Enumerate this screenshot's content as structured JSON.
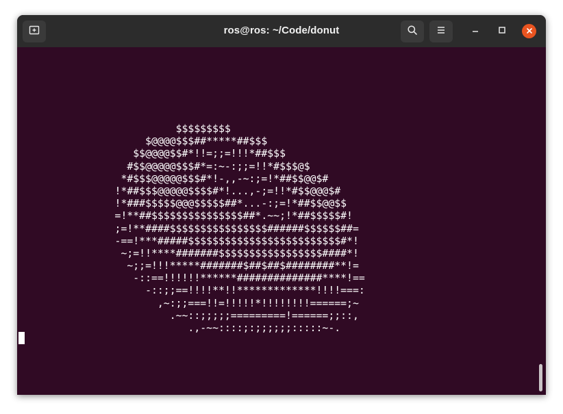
{
  "window": {
    "title": "ros@ros: ~/Code/donut"
  },
  "titlebar": {
    "buttons": [
      {
        "name": "new-tab",
        "icon": "new-tab-icon"
      },
      {
        "name": "search",
        "icon": "search-icon"
      },
      {
        "name": "menu",
        "icon": "hamburger-menu-icon"
      }
    ],
    "window_controls": [
      {
        "name": "minimize",
        "icon": "minimize-icon"
      },
      {
        "name": "maximize",
        "icon": "maximize-icon"
      },
      {
        "name": "close",
        "icon": "close-icon"
      }
    ]
  },
  "terminal": {
    "background": "#300a24",
    "foreground": "#ffffff",
    "output_lines": [
      "                          $$$$$$$$$",
      "                     $@@@@$$$##*****##$$$",
      "                   $$@@@@$$#*!!=;;=!!!*##$$$",
      "                  #$$@@@@@$$$#*=:~-:;;=!!*#$$$@$",
      "                 *#$$$@@@@@$$$#*!-,,-~:;=!*##$$@@$#",
      "                !*##$$$@@@@@$$$$#*!...,-;=!!*#$$@@@$#",
      "                !*###$$$$$@@@$$$$$##*...-:;=!*##$$@@$$",
      "                =!**##$$$$$$$$$$$$$$$##*.~~;!*##$$$$$#!",
      "                ;=!**####$$$$$$$$$$$$$$$$######$$$$$$##=",
      "                -==!***#####$$$$$$$$$$$$$$$$$$$$$$$$$#*!",
      "                 ~;=!!****#######$$$$$$$$$$$$$$$$$####*!",
      "                  ~;;=!!!*****#######$##$##$########**!=",
      "                   -::==!!!!!!******##############****!==",
      "                     -::;;==!!!!**!!*************!!!!===:",
      "                       ,~:;;===!!=!!!!!*!!!!!!!!======;~",
      "                         .~~::;;;;;=========!======;;::,",
      "                            .,-~~::::;:;;;;;;:::::~-."
    ]
  }
}
